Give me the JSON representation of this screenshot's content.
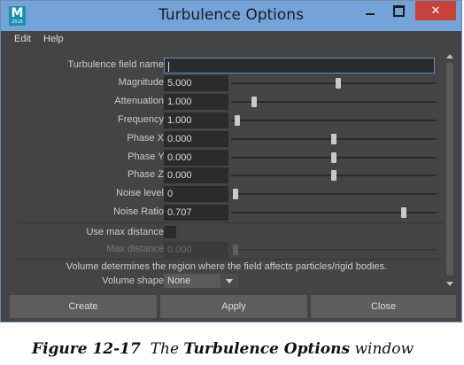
{
  "window": {
    "title": "Turbulence Options",
    "app_icon_letter": "M",
    "app_icon_sub": "2016",
    "minimize_icon": "minimize-icon",
    "maximize_icon": "maximize-icon",
    "close_glyph": "✕"
  },
  "menu": [
    "Edit",
    "Help"
  ],
  "fields": {
    "field_name": {
      "label": "Turbulence field name:",
      "value": ""
    },
    "magnitude": {
      "label": "Magnitude:",
      "value": "5.000",
      "slider": 0.52
    },
    "attenuation": {
      "label": "Attenuation:",
      "value": "1.000",
      "slider": 0.11
    },
    "frequency": {
      "label": "Frequency:",
      "value": "1.000",
      "slider": 0.03
    },
    "phase_x": {
      "label": "Phase X:",
      "value": "0.000",
      "slider": 0.5
    },
    "phase_y": {
      "label": "Phase Y:",
      "value": "0.000",
      "slider": 0.5
    },
    "phase_z": {
      "label": "Phase Z:",
      "value": "0.000",
      "slider": 0.5
    },
    "noise_level": {
      "label": "Noise level:",
      "value": "0",
      "slider": 0.02
    },
    "noise_ratio": {
      "label": "Noise Ratio:",
      "value": "0.707",
      "slider": 0.84
    },
    "use_max_distance": {
      "label": "Use max distance:",
      "checked": false
    },
    "max_distance": {
      "label": "Max distance:",
      "value": "0.000",
      "slider": 0.02,
      "disabled": true
    }
  },
  "volume": {
    "info": "Volume determines the region where the field affects particles/rigid bodies.",
    "shape_label": "Volume shape:",
    "shape_value": "None"
  },
  "buttons": {
    "create": "Create",
    "apply": "Apply",
    "close": "Close"
  },
  "caption": {
    "prefix": "Figure 12-17",
    "the": "The",
    "bold": "Turbulence Options",
    "suffix": "window"
  }
}
